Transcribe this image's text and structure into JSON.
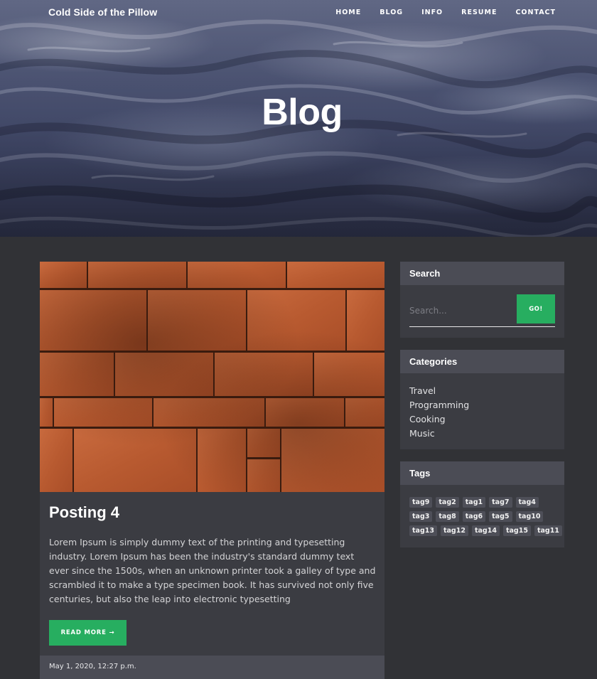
{
  "site": {
    "brand": "Cold Side of the Pillow"
  },
  "nav": {
    "items": [
      "HOME",
      "BLOG",
      "INFO",
      "RESUME",
      "CONTACT"
    ]
  },
  "hero": {
    "title": "Blog"
  },
  "post": {
    "title": "Posting 4",
    "body": "Lorem Ipsum is simply dummy text of the printing and typesetting industry. Lorem Ipsum has been the industry's standard dummy text ever since the 1500s, when an unknown printer took a galley of type and scrambled it to make a type specimen book. It has survived not only five centuries, but also the leap into electronic typesetting",
    "read_more_label": "READ MORE →",
    "date": "May 1, 2020, 12:27 p.m."
  },
  "sidebar": {
    "search": {
      "title": "Search",
      "placeholder": "Search...",
      "button_label": "GO!"
    },
    "categories": {
      "title": "Categories",
      "items": [
        "Travel",
        "Programming",
        "Cooking",
        "Music"
      ]
    },
    "tags": {
      "title": "Tags",
      "items": [
        "tag9",
        "tag2",
        "tag1",
        "tag7",
        "tag4",
        "tag3",
        "tag8",
        "tag6",
        "tag5",
        "tag10",
        "tag13",
        "tag12",
        "tag14",
        "tag15",
        "tag11"
      ]
    }
  },
  "colors": {
    "accent_green": "#27ae60",
    "page_background": "#313236",
    "card_background": "#3b3c42",
    "card_header": "#4b4c55"
  },
  "icons": {
    "read_more_arrow": "arrow-right-icon"
  }
}
